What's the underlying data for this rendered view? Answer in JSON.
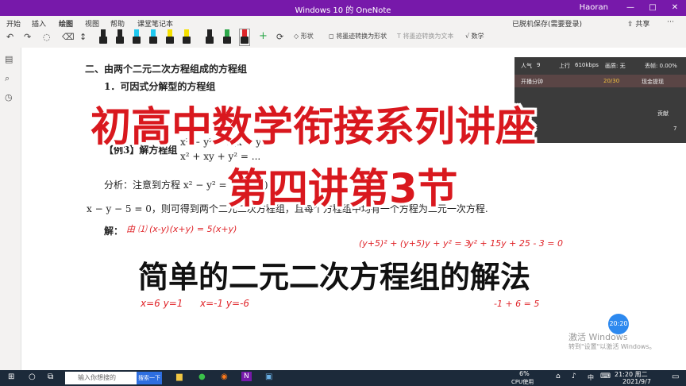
{
  "window": {
    "title": "Windows 10 的 OneNote",
    "user": "Haoran",
    "controls": [
      "—",
      "□",
      "✕"
    ]
  },
  "menu": {
    "tabs": [
      "开始",
      "插入",
      "绘图",
      "视图",
      "帮助",
      "课堂笔记本"
    ],
    "active_tab": "绘图",
    "status": "已脱机保存(需要登录)",
    "share": "共享"
  },
  "toolbar": {
    "pen_colors": [
      "#222222",
      "#222222",
      "#1ec8f0",
      "#1ec8f0",
      "#f5e000",
      "#f5e000",
      "#222222",
      "#2da84a",
      "#e0262b"
    ],
    "shape_label": "形状",
    "ink_to_shape_label": "将墨迹转换为形状",
    "ink_to_text_label": "将墨迹转换为文本",
    "math_label": "数学"
  },
  "document": {
    "section_heading": "二、由两个二元二次方程组成的方程组",
    "subsection": "1．可因式分解型的方程组",
    "example_label": "【例3】解方程组",
    "eq1": "x² − y² = 5(x + y)",
    "eq2": "x² + xy + y² = ...",
    "analysis": "分析：注意到方程 x² − y² = 5(x + y) ...",
    "line_cont": "x − y − 5 = 0，则可得到两个二元二次方程组，且每个方程组中均有一个方程为二元一次方程.",
    "solution_label": "解：",
    "hw_line1": "由 ⑴ (x-y)(x+y) = 5(x+y)",
    "hw_line2": "(y+5)² + (y+5)y + y² = 3",
    "hw_line3": "y² + 15y + 25 - 3 = 0",
    "hw_sol_a": "x=6  y=1",
    "hw_sol_b": "x=-1  y=-6",
    "hw_line4": "-1 + 6 = 5"
  },
  "overlay": {
    "title1": "初高中数学衔接系列讲座",
    "title2": "第四讲第3节",
    "subtitle": "简单的二元二次方程组的解法"
  },
  "stream": {
    "popularity_label": "人气",
    "popularity": "9",
    "upload_label": "上行",
    "upload": "610kbps",
    "quality_label": "画质: 无",
    "loss_label": "丢帧: 0.00%",
    "duration_label": "开播分钟",
    "duration": "20/30",
    "cash_label": "现金提现",
    "contribution_label": "贡献",
    "count": "7"
  },
  "watermark": {
    "line1": "激活 Windows",
    "line2": "转到\"设置\"以激活 Windows。",
    "time_badge": "20:20"
  },
  "taskbar": {
    "search_placeholder": "输入你想搜的",
    "search_button": "搜索一下",
    "cpu": "6%",
    "cpu_label": "CPU使用",
    "ime": "中",
    "time": "21:20 周二",
    "date": "2021/9/7"
  }
}
